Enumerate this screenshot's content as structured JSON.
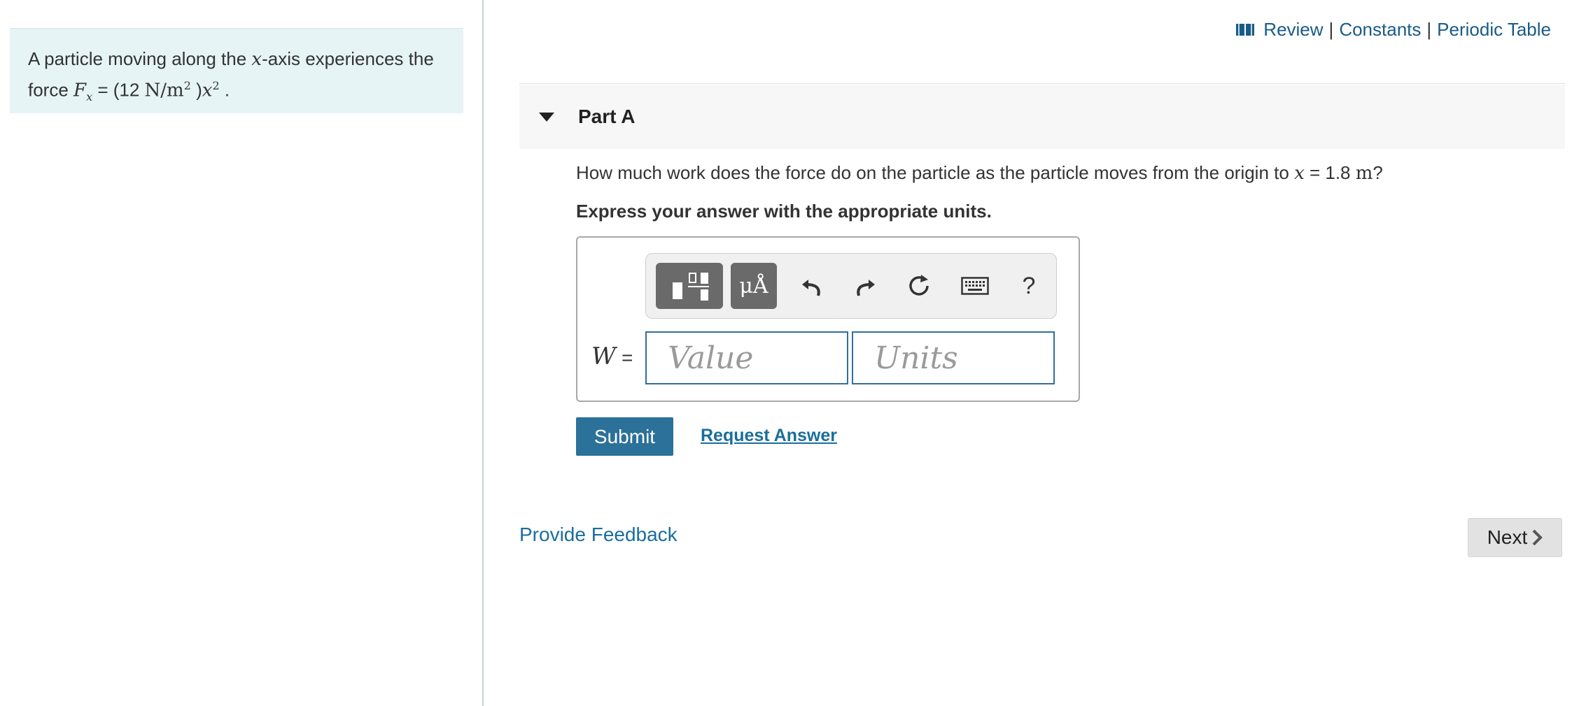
{
  "problem": {
    "text_before": "A particle moving along the ",
    "var_x": "x",
    "text_after": "-axis experiences the",
    "force_word": "force ",
    "force_symbol": "F",
    "force_subscript": "x",
    "equals": " = (12 ",
    "unit": "N/m",
    "unit_exp": "2",
    "close": " )",
    "var_x2": "x",
    "x_exp": "2",
    "period": " ."
  },
  "top_links": {
    "review": "Review",
    "separator": "|",
    "constants": "Constants",
    "periodic_table": "Periodic Table"
  },
  "part": {
    "title": "Part A",
    "question_before": "How much work does the force do on the particle as the particle moves from the origin to ",
    "question_var": "x",
    "question_equals": " = 1.8 ",
    "question_unit": "m",
    "question_end": "?",
    "instruction": "Express your answer with the appropriate units."
  },
  "answer": {
    "label": "W",
    "equals": "=",
    "value_placeholder": "Value",
    "units_placeholder": "Units",
    "units_button_label": "μÅ",
    "help_label": "?"
  },
  "actions": {
    "submit": "Submit",
    "request_answer": "Request Answer",
    "provide_feedback": "Provide Feedback",
    "next": "Next"
  },
  "colors": {
    "problem_bg": "#e6f4f6",
    "link": "#1a5b86",
    "submit_bg": "#2b7199",
    "input_border": "#2f6f9e"
  }
}
